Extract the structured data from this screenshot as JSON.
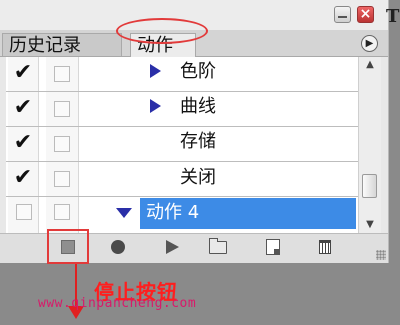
{
  "window": {
    "title_fragment": "T"
  },
  "tabs": [
    {
      "label": "历史记录",
      "active": false
    },
    {
      "label": "动作",
      "active": true
    }
  ],
  "rows": [
    {
      "label": "色阶",
      "checked": true,
      "expand": "right",
      "indent": 1
    },
    {
      "label": "曲线",
      "checked": true,
      "expand": "right",
      "indent": 1
    },
    {
      "label": "存储",
      "checked": true,
      "expand": "",
      "indent": 1
    },
    {
      "label": "关闭",
      "checked": true,
      "expand": "",
      "indent": 1
    },
    {
      "label": "动作 4",
      "checked": false,
      "expand": "down",
      "selected": true
    }
  ],
  "toolbar": {
    "buttons": [
      "stop-icon",
      "record-icon",
      "play-icon",
      "new-set-icon",
      "new-action-icon",
      "delete-icon"
    ]
  },
  "annotation": {
    "label": "停止按钮",
    "color": "#ff1e1e"
  },
  "watermark": {
    "text": "www.qinpancheng.com"
  },
  "colors": {
    "selection": "#3d8be6",
    "expander": "#2a2fa8",
    "annotation": "#e23a3a"
  }
}
